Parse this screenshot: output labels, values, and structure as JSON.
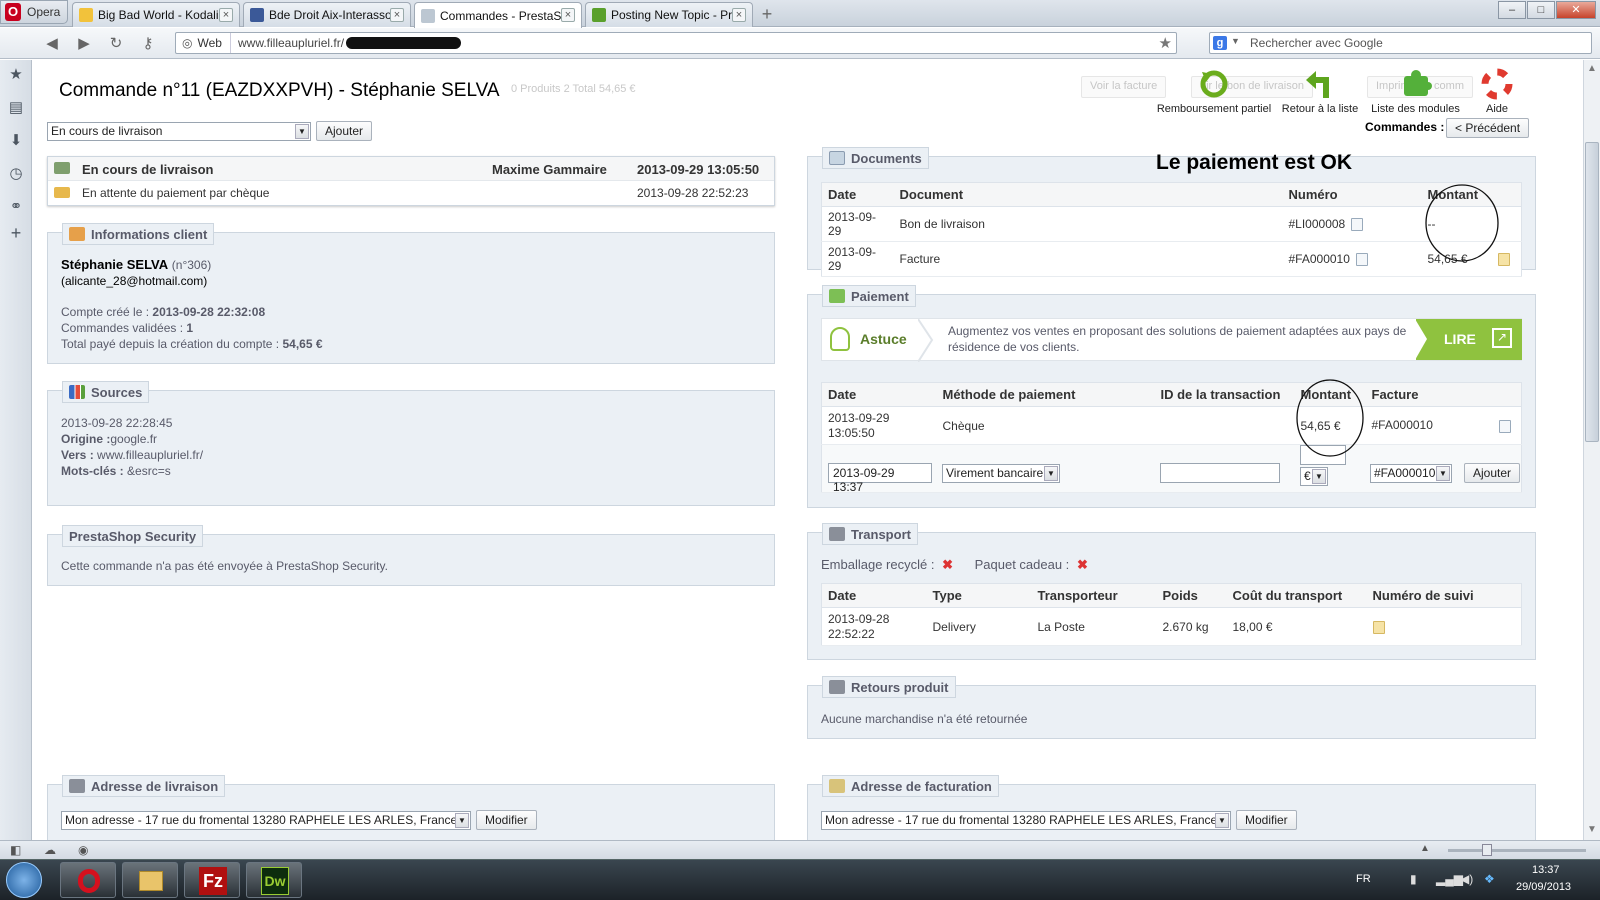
{
  "browser": {
    "menu_label": "Opera",
    "tabs": [
      {
        "label": "Big Bad World - Kodali..."
      },
      {
        "label": "Bde Droit Aix-Interasso"
      },
      {
        "label": "Commandes - PrestaS..."
      },
      {
        "label": "Posting New Topic - Pr..."
      }
    ],
    "new_tab_symbol": "+",
    "address_mode": "Web",
    "url": "www.filleaupluriel.fr/",
    "search_placeholder": "Rechercher avec Google"
  },
  "header": {
    "title": "Commande n°11 (EAZDXXPVH) - Stéphanie SELVA",
    "faint_stats": "0   Produits   2   Total   54,65 €",
    "faint_buttons": [
      "Voir la facture",
      "oir le bon de livraison",
      "Imprimer la comm"
    ],
    "toolbar": [
      {
        "label": "Remboursement partiel",
        "icon": "refund-icon"
      },
      {
        "label": "Retour à la liste",
        "icon": "back-arrow-icon"
      },
      {
        "label": "Liste des modules",
        "icon": "puzzle-icon"
      },
      {
        "label": "Aide",
        "icon": "help-lifebuoy-icon"
      }
    ],
    "commandes_label": "Commandes :",
    "prev_button": "< Précédent"
  },
  "status_form": {
    "selected": "En cours de livraison",
    "add_button": "Ajouter"
  },
  "history": [
    {
      "status": "En cours de livraison",
      "employee": "Maxime Gammaire",
      "date": "2013-09-29 13:05:50"
    },
    {
      "status": "En attente du paiement par chèque",
      "employee": "",
      "date": "2013-09-28 22:52:23"
    }
  ],
  "client": {
    "legend": "Informations client",
    "name": "Stéphanie SELVA",
    "number": "(n°306)",
    "email": "(alicante_28@hotmail.com)",
    "created_label": "Compte créé le :",
    "created_value": "2013-09-28 22:32:08",
    "validated_label": "Commandes validées :",
    "validated_value": "1",
    "total_label": "Total payé depuis la création du compte :",
    "total_value": "54,65 €"
  },
  "sources": {
    "legend": "Sources",
    "date": "2013-09-28 22:28:45",
    "origin_label": "Origine :",
    "origin_value": "google.fr",
    "to_label": "Vers :",
    "to_value": "www.filleaupluriel.fr/",
    "keywords_label": "Mots-clés :",
    "keywords_value": "&esrc=s"
  },
  "security": {
    "legend": "PrestaShop Security",
    "text": "Cette commande n'a pas été envoyée à PrestaShop Security."
  },
  "documents": {
    "legend": "Documents",
    "annotation": "Le paiement est OK",
    "headers": [
      "Date",
      "Document",
      "Numéro",
      "Montant"
    ],
    "rows": [
      {
        "date": "2013-09-29",
        "document": "Bon de livraison",
        "number": "#LI000008",
        "amount": "--"
      },
      {
        "date": "2013-09-29",
        "document": "Facture",
        "number": "#FA000010",
        "amount": "54,65 €"
      }
    ]
  },
  "payment": {
    "legend": "Paiement",
    "tip_label": "Astuce",
    "tip_text": "Augmentez vos ventes en proposant des solutions de paiement adaptées aux pays de résidence de vos clients.",
    "tip_button": "LIRE",
    "headers": [
      "Date",
      "Méthode de paiement",
      "ID de la transaction",
      "Montant",
      "Facture"
    ],
    "row": {
      "date_line1": "2013-09-29",
      "date_line2": "13:05:50",
      "method": "Chèque",
      "amount": "54,65 €",
      "invoice": "#FA000010"
    },
    "form": {
      "date": "2013-09-29 13:37",
      "method": "Virement bancaire",
      "currency": "€",
      "invoice": "#FA000010",
      "add_button": "Ajouter"
    }
  },
  "transport": {
    "legend": "Transport",
    "recycled_label": "Emballage recyclé :",
    "gift_label": "Paquet cadeau :",
    "headers": [
      "Date",
      "Type",
      "Transporteur",
      "Poids",
      "Coût du transport",
      "Numéro de suivi"
    ],
    "row": {
      "date_line1": "2013-09-28",
      "date_line2": "22:52:22",
      "type": "Delivery",
      "carrier": "La Poste",
      "weight": "2.670 kg",
      "cost": "18,00 €"
    }
  },
  "returns": {
    "legend": "Retours produit",
    "text": "Aucune marchandise n'a été retournée"
  },
  "shipping_address": {
    "legend": "Adresse de livraison",
    "value": "Mon adresse - 17 rue du fromental 13280 RAPHELE LES ARLES, France",
    "button": "Modifier"
  },
  "billing_address": {
    "legend": "Adresse de facturation",
    "value": "Mon adresse - 17 rue du fromental 13280 RAPHELE LES ARLES, France",
    "button": "Modifier"
  },
  "taskbar": {
    "lang": "FR",
    "time": "13:37",
    "date": "29/09/2013"
  },
  "colors": {
    "panel_bg": "#ebf0f5",
    "legend_text": "#585a69",
    "tip_green": "#8fc23f",
    "error_red": "#d33",
    "opera_red": "#c8001e"
  }
}
